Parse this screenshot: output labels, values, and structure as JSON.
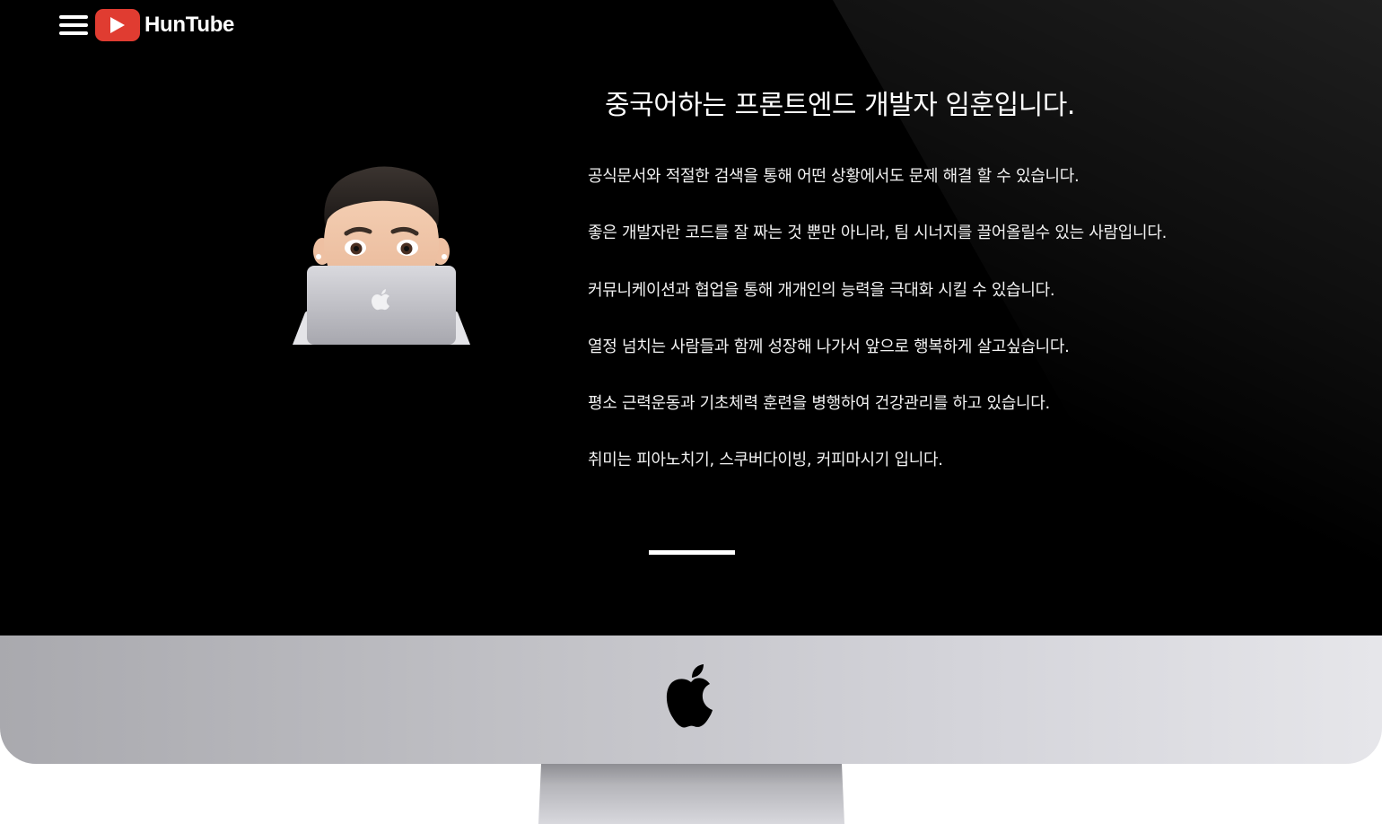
{
  "header": {
    "logo_text": "HunTube",
    "brand_color": "#e03c31",
    "menu_icon": "hamburger-menu-icon",
    "logo_icon": "play-icon"
  },
  "profile": {
    "avatar": "memoji-avatar-with-laptop",
    "title": "중국어하는 프론트엔드 개발자 임훈입니다.",
    "intro_lines": [
      "공식문서와 적절한 검색을 통해 어떤 상황에서도 문제 해결 할 수 있습니다.",
      "좋은 개발자란 코드를 잘 짜는 것 뿐만 아니라, 팀 시너지를 끌어올릴수 있는 사람입니다.",
      "커뮤니케이션과 협업을 통해 개개인의 능력을 극대화 시킬 수 있습니다.",
      "열정 넘치는 사람들과 함께 성장해 나가서 앞으로 행복하게 살고싶습니다.",
      "평소 근력운동과 기초체력 훈련을 병행하여 건강관리를 하고 있습니다.",
      "취미는 피아노치기, 스쿠버다이빙, 커피마시기 입니다."
    ]
  },
  "device": {
    "chin_icon": "apple-logo-icon",
    "screen_color": "#000000",
    "chin_color": "#c9c9ce"
  }
}
